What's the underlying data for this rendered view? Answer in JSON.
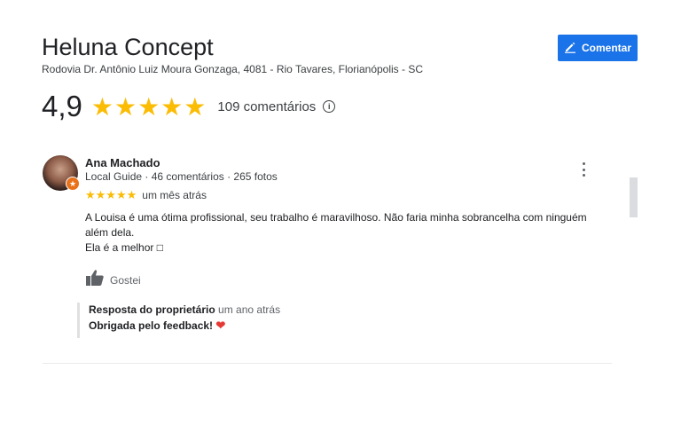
{
  "business": {
    "name": "Heluna Concept",
    "address": "Rodovia Dr. Antônio Luiz Moura Gonzaga, 4081 - Rio Tavares, Florianópolis - SC",
    "rating": "4,9",
    "stars": "★★★★★",
    "review_count": "109 comentários"
  },
  "actions": {
    "comment_label": "Comentar"
  },
  "review": {
    "author": "Ana Machado",
    "meta": "Local Guide · 46 comentários · 265 fotos",
    "stars": "★★★★★",
    "time": "um mês atrás",
    "text": "A Louisa é uma ótima profissional, seu trabalho é maravilhoso. Não faria minha sobrancelha com ninguém além dela.",
    "text2": "Ela é a melhor  □",
    "like_label": "Gostei",
    "owner_reply": {
      "title": "Resposta do proprietário",
      "time": "um ano atrás",
      "text": "Obrigada pelo feedback!",
      "emoji": "❤"
    }
  },
  "colors": {
    "accent": "#1a73e8",
    "star": "#fbbc04",
    "badge": "#e8711a",
    "heart": "#e53935"
  },
  "icons": [
    "pencil-icon",
    "info-icon",
    "more-vert-icon",
    "thumbs-up-icon",
    "local-guide-badge-icon"
  ]
}
